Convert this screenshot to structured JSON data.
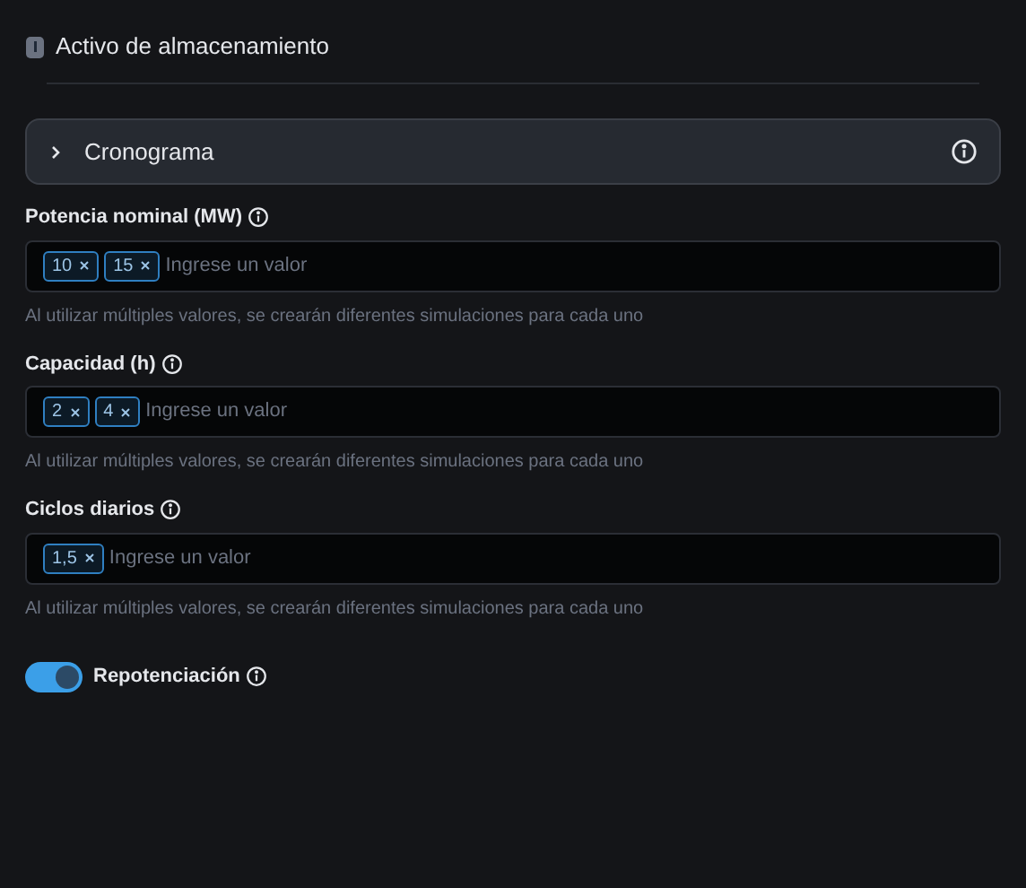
{
  "header": {
    "title": "Activo de almacenamiento"
  },
  "accordion": {
    "title": "Cronograma",
    "expanded": false
  },
  "fields": [
    {
      "label": "Potencia nominal (MW)",
      "tags": [
        "10",
        "15"
      ],
      "placeholder": "Ingrese un valor",
      "hint": "Al utilizar múltiples valores, se crearán diferentes simulaciones para cada uno"
    },
    {
      "label": "Capacidad (h)",
      "tags": [
        "2",
        "4"
      ],
      "placeholder": "Ingrese un valor",
      "hint": "Al utilizar múltiples valores, se crearán diferentes simulaciones para cada uno"
    },
    {
      "label": "Ciclos diarios",
      "tags": [
        "1,5"
      ],
      "placeholder": "Ingrese un valor",
      "hint": "Al utilizar múltiples valores, se crearán diferentes simulaciones para cada uno"
    }
  ],
  "toggle": {
    "label": "Repotenciación",
    "on": true
  }
}
